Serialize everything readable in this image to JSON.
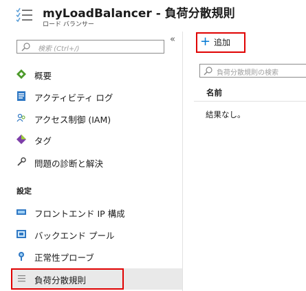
{
  "header": {
    "title": "myLoadBalancer - 負荷分散規則",
    "subtitle": "ロード バランサー",
    "icon": "load-balancing-rules-icon"
  },
  "sidebar": {
    "search_placeholder": "検索 (Ctrl+/)",
    "collapse_label": "«",
    "items": [
      {
        "label": "概要",
        "icon": "overview-icon"
      },
      {
        "label": "アクティビティ ログ",
        "icon": "activity-log-icon"
      },
      {
        "label": "アクセス制御 (IAM)",
        "icon": "iam-icon"
      },
      {
        "label": "タグ",
        "icon": "tag-icon"
      },
      {
        "label": "問題の診断と解決",
        "icon": "wrench-icon"
      }
    ],
    "settings_label": "設定",
    "settings_items": [
      {
        "label": "フロントエンド IP 構成",
        "icon": "frontend-ip-icon"
      },
      {
        "label": "バックエンド プール",
        "icon": "backend-pool-icon"
      },
      {
        "label": "正常性プローブ",
        "icon": "health-probe-icon"
      },
      {
        "label": "負荷分散規則",
        "icon": "load-balancing-rules-icon",
        "selected": true
      }
    ]
  },
  "main": {
    "add_label": "追加",
    "filter_placeholder": "負荷分散規則の検索",
    "column_header": "名前",
    "empty_message": "結果なし。"
  },
  "colors": {
    "accent": "#0078d4",
    "highlight": "#e00000",
    "selected_bg": "#e9e9e9"
  }
}
